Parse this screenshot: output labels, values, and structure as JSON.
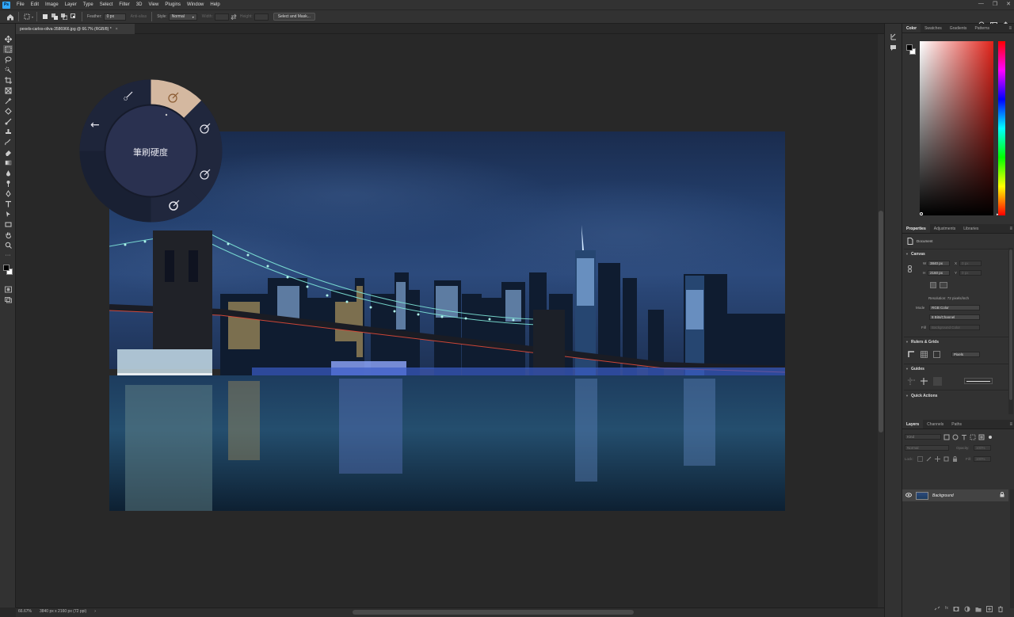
{
  "app": {
    "logo": "Ps"
  },
  "menu": [
    "File",
    "Edit",
    "Image",
    "Layer",
    "Type",
    "Select",
    "Filter",
    "3D",
    "View",
    "Plugins",
    "Window",
    "Help"
  ],
  "window_controls": [
    "—",
    "❐",
    "✕"
  ],
  "options": {
    "feather_label": "Feather:",
    "feather_value": "0 px",
    "antialias": "Anti-alias",
    "style_label": "Style:",
    "style_value": "Normal",
    "width_label": "Width:",
    "height_label": "Height:",
    "select_mask": "Select and Mask..."
  },
  "document": {
    "tab_title": "pexels-carlos-oliva-3586966.jpg @ 66.7% (RGB/8) *",
    "close": "×"
  },
  "status": {
    "zoom": "66.67%",
    "info": "3840 px x 2160 px (72 ppi)"
  },
  "radial_menu": {
    "center_label": "筆刷硬度",
    "back": "←"
  },
  "color_panel": {
    "tabs": [
      "Color",
      "Swatches",
      "Gradients",
      "Patterns"
    ],
    "fg": "#000000",
    "bg": "#ffffff",
    "hue": "#e0231a"
  },
  "properties": {
    "tabs": [
      "Properties",
      "Adjustments",
      "Libraries"
    ],
    "doc_label": "Document",
    "canvas_section": "Canvas",
    "w_label": "W",
    "w_value": "3840 px",
    "h_label": "H",
    "h_value": "2160 px",
    "x_label": "X",
    "x_value": "0 px",
    "y_label": "Y",
    "y_value": "0 px",
    "resolution": "Resolution: 72 pixels/inch",
    "mode_label": "Mode",
    "mode_value": "RGB Color",
    "depth_value": "8 Bits/Channel",
    "fill_label": "Fill",
    "fill_value": "Background Color",
    "rulers_section": "Rulers & Grids",
    "units_value": "Pixels",
    "guides_section": "Guides",
    "quick_section": "Quick Actions"
  },
  "layers": {
    "tabs": [
      "Layers",
      "Channels",
      "Paths"
    ],
    "search_placeholder": "Kind",
    "blend_mode": "Normal",
    "opacity_label": "Opacity:",
    "opacity_value": "100%",
    "lock_label": "Lock:",
    "fill_label": "Fill:",
    "fill_value": "100%",
    "layer_name": "Background"
  }
}
